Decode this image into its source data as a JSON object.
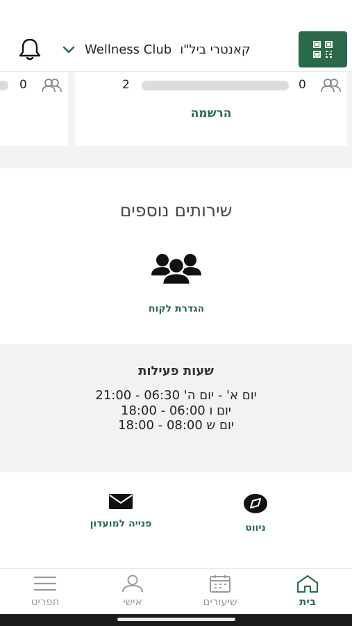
{
  "header": {
    "club_name": "Wellness Club",
    "club_suffix": "קאנטרי ביל\"ו"
  },
  "cards": {
    "left": {
      "count": "0"
    },
    "main": {
      "count_left": "2",
      "count_right": "0",
      "register_label": "הרשמה"
    }
  },
  "services": {
    "title": "שירותים נוספים",
    "item_label": "הגדרת לקוח"
  },
  "hours": {
    "title": "שעות פעילות",
    "lines": [
      "יום א' - יום ה' 06:30 - 21:00",
      "יום ו 06:00 - 18:00",
      "יום ש 08:00 - 18:00"
    ]
  },
  "actions": {
    "contact_label": "פנייה למועדון",
    "navigation_label": "ניווט"
  },
  "bottom_nav": {
    "menu": "תפריט",
    "personal": "אישי",
    "classes": "שיעורים",
    "home": "בית"
  },
  "colors": {
    "brand": "#2a6a4a"
  }
}
